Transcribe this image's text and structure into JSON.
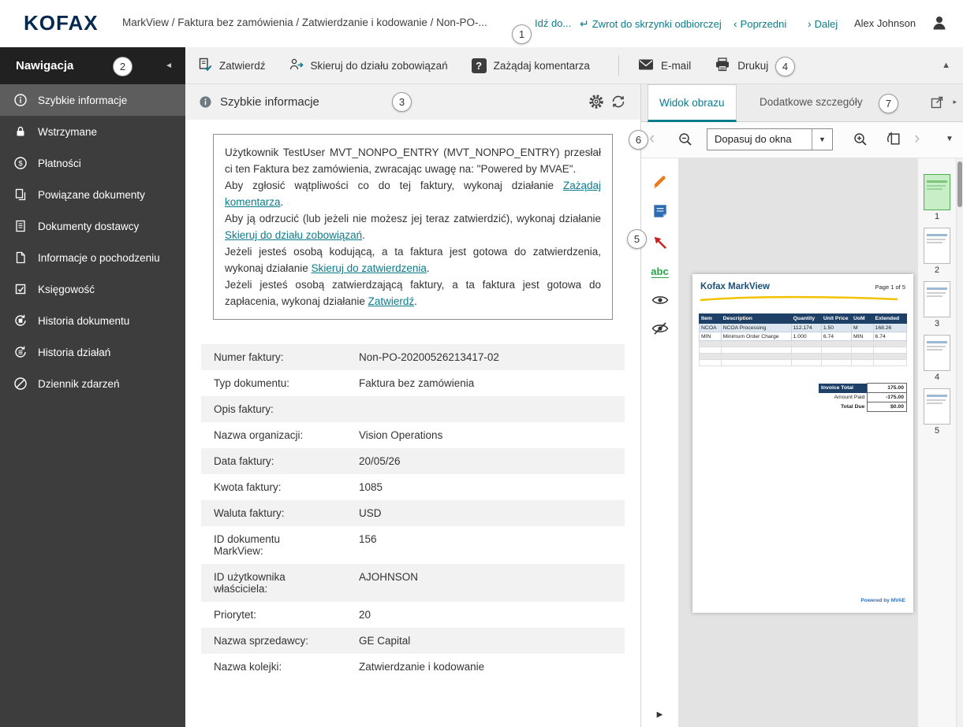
{
  "glyphs": {
    "return_arrow": "↵",
    "prev_chevron": "‹",
    "next_chevron": "›",
    "collapse_left": "◄",
    "collapse_up": "▲",
    "caret_down": "▼",
    "expand_right": "▶",
    "external_caret": "▸",
    "question_mark": "?",
    "abc": "abc"
  },
  "topbar": {
    "logo": "KOFAX",
    "breadcrumb": "MarkView / Faktura bez zamówienia / Zatwierdzanie i kodowanie / Non-PO-...",
    "goto_label": "Idź do...",
    "return_label": "Zwrot do skrzynki odbiorczej",
    "prev_label": "Poprzedni",
    "next_label": "Dalej",
    "user_name": "Alex Johnson"
  },
  "sidebar": {
    "title": "Nawigacja",
    "items": [
      {
        "label": "Szybkie informacje"
      },
      {
        "label": "Wstrzymane"
      },
      {
        "label": "Płatności"
      },
      {
        "label": "Powiązane dokumenty"
      },
      {
        "label": "Dokumenty dostawcy"
      },
      {
        "label": "Informacje o pochodzeniu"
      },
      {
        "label": "Księgowość"
      },
      {
        "label": "Historia dokumentu"
      },
      {
        "label": "Historia działań"
      },
      {
        "label": "Dziennik zdarzeń"
      }
    ]
  },
  "toolbar": {
    "approve_label": "Zatwierdź",
    "route_label": "Skieruj do działu zobowiązań",
    "request_comment_label": "Zażądaj komentarza",
    "email_label": "E-mail",
    "print_label": "Drukuj"
  },
  "quick_info": {
    "title": "Szybkie informacje",
    "message": {
      "p1": "Użytkownik TestUser MVT_NONPO_ENTRY (MVT_NONPO_ENTRY) przesłał ci ten Faktura bez zamówienia, zwracając uwagę na: \"Powered by MVAE\".",
      "p2_pre": "Aby zgłosić wątpliwości co do tej faktury, wykonaj działanie ",
      "p2_link": "Zażądaj komentarza",
      "p3_pre": "Aby ją odrzucić (lub jeżeli nie możesz jej teraz zatwierdzić), wykonaj działanie ",
      "p3_link": "Skieruj do działu zobowiązań",
      "p4_pre": "Jeżeli jesteś osobą kodującą, a ta faktura jest gotowa do zatwierdzenia, wykonaj działanie ",
      "p4_link": "Skieruj do zatwierdzenia",
      "p5_pre": "Jeżeli jesteś osobą zatwierdzającą faktury, a ta faktura jest gotowa do zapłacenia, wykonaj działanie ",
      "p5_link": "Zatwierdź",
      "period": "."
    },
    "fields": [
      {
        "label": "Numer faktury:",
        "value": "Non-PO-20200526213417-02"
      },
      {
        "label": "Typ dokumentu:",
        "value": "Faktura bez zamówienia"
      },
      {
        "label": "Opis faktury:",
        "value": ""
      },
      {
        "label": "Nazwa organizacji:",
        "value": "Vision Operations"
      },
      {
        "label": "Data faktury:",
        "value": "20/05/26"
      },
      {
        "label": "Kwota faktury:",
        "value": "1085"
      },
      {
        "label": "Waluta faktury:",
        "value": "USD"
      },
      {
        "label": "ID dokumentu MarkView:",
        "value": "156"
      },
      {
        "label": "ID użytkownika właściciela:",
        "value": "AJOHNSON"
      },
      {
        "label": "Priorytet:",
        "value": "20"
      },
      {
        "label": "Nazwa sprzedawcy:",
        "value": "GE Capital"
      },
      {
        "label": "Nazwa kolejki:",
        "value": "Zatwierdzanie i kodowanie"
      }
    ]
  },
  "viewer": {
    "tab_image": "Widok obrazu",
    "tab_details": "Dodatkowe szczegóły",
    "zoom_value": "Dopasuj do okna",
    "thumbnails": [
      {
        "page": "1",
        "selected": true
      },
      {
        "page": "2",
        "selected": false
      },
      {
        "page": "3",
        "selected": false
      },
      {
        "page": "4",
        "selected": false
      },
      {
        "page": "5",
        "selected": false
      }
    ]
  },
  "invoice": {
    "brand": "Kofax MarkView",
    "page_label": "Page 1 of 5",
    "table": {
      "headers": [
        "Item",
        "Description",
        "Quantity",
        "Unit Price",
        "UoM",
        "Extended"
      ],
      "rows": [
        [
          "NCOA",
          "NCOA Processing",
          "112.174",
          "1.50",
          "M",
          "168.26"
        ],
        [
          "MIN",
          "Minimum Order Charge",
          "1.000",
          "6.74",
          "MIN",
          "6.74"
        ]
      ]
    },
    "totals": [
      {
        "label": "Invoice Total",
        "value": "175.00"
      },
      {
        "label": "Amount Paid",
        "value": "-175.00"
      },
      {
        "label": "Total Due",
        "value": "$0.00"
      }
    ],
    "footer": "Powered by MVAE"
  },
  "callouts": {
    "c1": "1",
    "c2": "2",
    "c3": "3",
    "c4": "4",
    "c5": "5",
    "c6": "6",
    "c7": "7"
  },
  "colors": {
    "teal": "#0b7c8b",
    "logo_navy": "#04284f",
    "sidebar_bg": "#3d3d3d",
    "table_header_blue": "#1f4066"
  }
}
